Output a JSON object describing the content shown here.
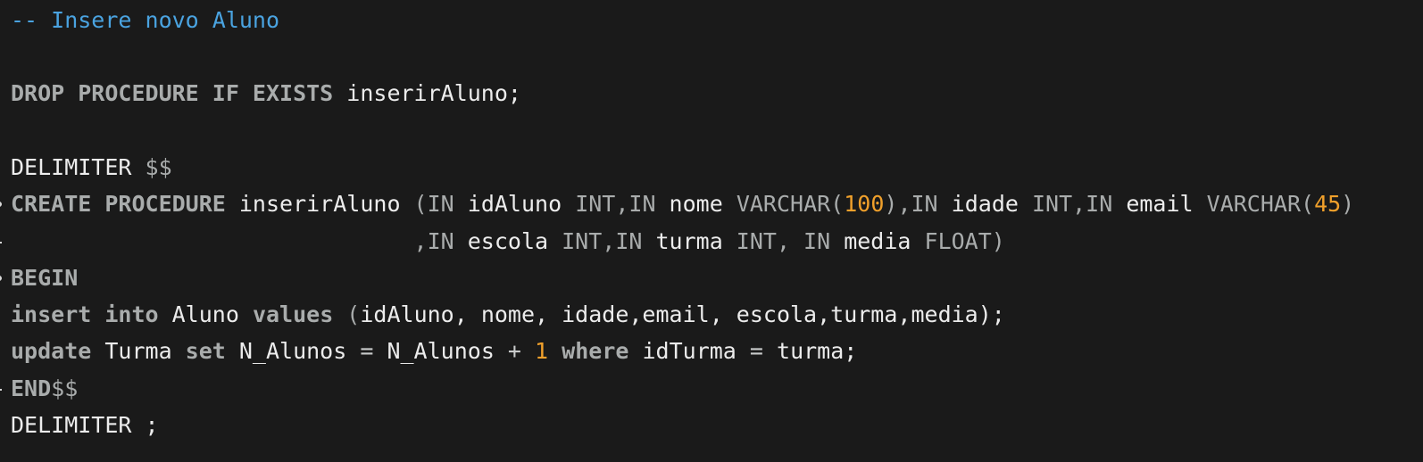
{
  "editor": {
    "lines": [
      {
        "tokens": [
          {
            "text": "-- Insere novo Aluno",
            "kind": "comment"
          }
        ]
      },
      {
        "tokens": []
      },
      {
        "tokens": [
          {
            "text": "DROP PROCEDURE IF EXISTS",
            "kind": "kw"
          },
          {
            "text": " inserirAluno;",
            "kind": "ident"
          }
        ]
      },
      {
        "tokens": []
      },
      {
        "tokens": [
          {
            "text": "DELIMITER ",
            "kind": "ident"
          },
          {
            "text": "$$",
            "kind": "punct"
          }
        ]
      },
      {
        "tokens": [
          {
            "text": "CREATE PROCEDURE",
            "kind": "kw"
          },
          {
            "text": " inserirAluno ",
            "kind": "ident"
          },
          {
            "text": "(",
            "kind": "punct"
          },
          {
            "text": "IN",
            "kind": "type"
          },
          {
            "text": " idAluno ",
            "kind": "ident"
          },
          {
            "text": "INT,IN",
            "kind": "type"
          },
          {
            "text": " nome ",
            "kind": "ident"
          },
          {
            "text": "VARCHAR(",
            "kind": "type"
          },
          {
            "text": "100",
            "kind": "num"
          },
          {
            "text": "),IN",
            "kind": "type"
          },
          {
            "text": " idade ",
            "kind": "ident"
          },
          {
            "text": "INT,IN",
            "kind": "type"
          },
          {
            "text": " email ",
            "kind": "ident"
          },
          {
            "text": "VARCHAR(",
            "kind": "type"
          },
          {
            "text": "45",
            "kind": "num"
          },
          {
            "text": ")",
            "kind": "type"
          }
        ]
      },
      {
        "tokens": [
          {
            "text": "                              ",
            "kind": "ident"
          },
          {
            "text": ",IN",
            "kind": "type"
          },
          {
            "text": " escola ",
            "kind": "ident"
          },
          {
            "text": "INT,IN",
            "kind": "type"
          },
          {
            "text": " turma ",
            "kind": "ident"
          },
          {
            "text": "INT, IN",
            "kind": "type"
          },
          {
            "text": " media ",
            "kind": "ident"
          },
          {
            "text": "FLOAT)",
            "kind": "type"
          }
        ]
      },
      {
        "tokens": [
          {
            "text": "BEGIN",
            "kind": "kw"
          }
        ]
      },
      {
        "tokens": [
          {
            "text": "insert into",
            "kind": "kw"
          },
          {
            "text": " Aluno ",
            "kind": "ident"
          },
          {
            "text": "values",
            "kind": "kw"
          },
          {
            "text": " (",
            "kind": "punct"
          },
          {
            "text": "idAluno, nome, idade,email, escola,turma,media);",
            "kind": "ident"
          }
        ]
      },
      {
        "tokens": [
          {
            "text": "update",
            "kind": "kw"
          },
          {
            "text": " Turma ",
            "kind": "ident"
          },
          {
            "text": "set",
            "kind": "kw"
          },
          {
            "text": " N_Alunos ",
            "kind": "ident"
          },
          {
            "text": "=",
            "kind": "op"
          },
          {
            "text": " N_Alunos ",
            "kind": "ident"
          },
          {
            "text": "+",
            "kind": "op"
          },
          {
            "text": " ",
            "kind": "ident"
          },
          {
            "text": "1",
            "kind": "num"
          },
          {
            "text": " ",
            "kind": "ident"
          },
          {
            "text": "where",
            "kind": "kw"
          },
          {
            "text": " idTurma ",
            "kind": "ident"
          },
          {
            "text": "=",
            "kind": "op"
          },
          {
            "text": " turma;",
            "kind": "ident"
          }
        ]
      },
      {
        "tokens": [
          {
            "text": "END",
            "kind": "kw"
          },
          {
            "text": "$$",
            "kind": "punct"
          }
        ]
      },
      {
        "tokens": [
          {
            "text": "DELIMITER ;",
            "kind": "ident"
          }
        ]
      }
    ]
  },
  "colors": {
    "background": "#1a1a1a",
    "comment": "#4aa3e0",
    "keyword": "#a9acac",
    "identifier": "#ececec",
    "number": "#f0a02b"
  }
}
